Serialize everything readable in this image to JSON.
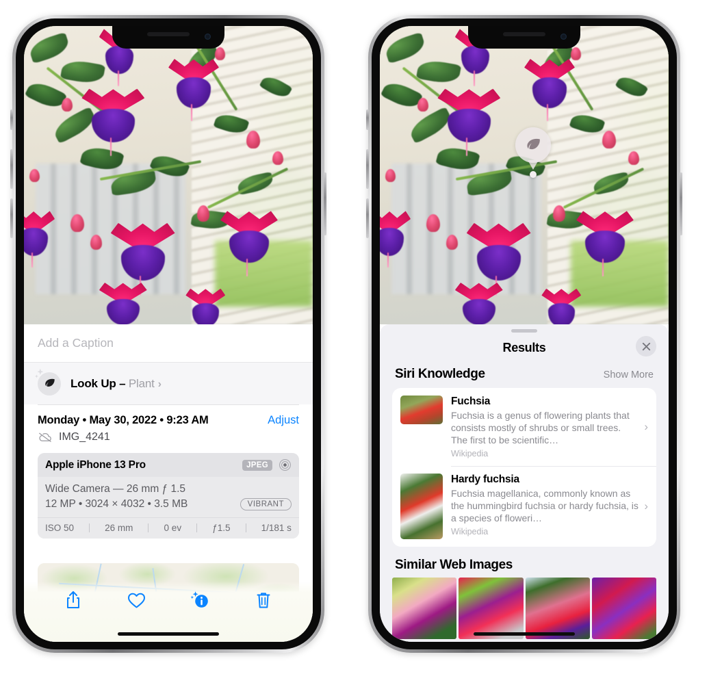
{
  "left_phone": {
    "photo_alt": "fuchsia-flowers-photo",
    "caption_placeholder": "Add a Caption",
    "lookup": {
      "icon": "leaf-icon",
      "sparkle_icon": "sparkle-icon",
      "label": "Look Up – ",
      "subject": "Plant",
      "chevron": "›"
    },
    "meta": {
      "date": "Monday • May 30, 2022 • 9:23 AM",
      "adjust_label": "Adjust",
      "cloud_icon": "icloud-slash-icon",
      "filename": "IMG_4241"
    },
    "camera": {
      "device": "Apple iPhone 13 Pro",
      "format_badge": "JPEG",
      "raw_icon": "aperture-icon",
      "lens": "Wide Camera — 26 mm ƒ 1.5",
      "specs": "12 MP • 3024 × 4032 • 3.5 MB",
      "style_badge": "VIBRANT",
      "exif": [
        "ISO 50",
        "26 mm",
        "0 ev",
        "ƒ1.5",
        "1/181 s"
      ]
    },
    "toolbar": [
      {
        "name": "share-icon",
        "label": "Share"
      },
      {
        "name": "heart-icon",
        "label": "Favorite"
      },
      {
        "name": "info-sparkle-icon",
        "label": "Info"
      },
      {
        "name": "trash-icon",
        "label": "Delete"
      }
    ]
  },
  "right_phone": {
    "photo_alt": "fuchsia-flowers-photo",
    "visual_lookup_badge": {
      "icon": "leaf-icon"
    },
    "sheet": {
      "title": "Results",
      "close_icon": "close-icon",
      "sections": [
        {
          "title": "Siri Knowledge",
          "action": "Show More",
          "cards": [
            {
              "title": "Fuchsia",
              "description": "Fuchsia is a genus of flowering plants that consists mostly of shrubs or small trees. The first to be scientific…",
              "source": "Wikipedia",
              "chevron": "›"
            },
            {
              "title": "Hardy fuchsia",
              "description": "Fuchsia magellanica, commonly known as the hummingbird fuchsia or hardy fuchsia, is a species of floweri…",
              "source": "Wikipedia",
              "chevron": "›"
            }
          ]
        },
        {
          "title": "Similar Web Images",
          "images": [
            "similar-image-1",
            "similar-image-2",
            "similar-image-3",
            "similar-image-4"
          ]
        }
      ]
    }
  },
  "colors": {
    "accent_blue": "#0b84ff",
    "sheet_bg": "#f1f1f5",
    "card_bg": "#ffffff",
    "secondary_text": "#8a8a90"
  }
}
